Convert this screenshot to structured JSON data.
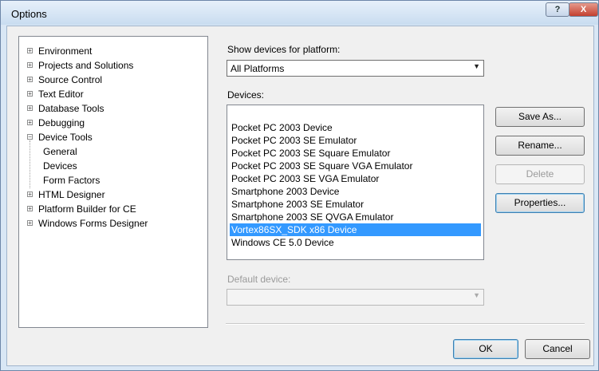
{
  "window": {
    "title": "Options",
    "help_label": "?",
    "close_label": "X"
  },
  "tree": {
    "items": [
      {
        "label": "Environment",
        "expander": "+",
        "level": 0
      },
      {
        "label": "Projects and Solutions",
        "expander": "+",
        "level": 0
      },
      {
        "label": "Source Control",
        "expander": "+",
        "level": 0
      },
      {
        "label": "Text Editor",
        "expander": "+",
        "level": 0
      },
      {
        "label": "Database Tools",
        "expander": "+",
        "level": 0
      },
      {
        "label": "Debugging",
        "expander": "+",
        "level": 0
      },
      {
        "label": "Device Tools",
        "expander": "−",
        "level": 0
      },
      {
        "label": "General",
        "expander": "",
        "level": 1
      },
      {
        "label": "Devices",
        "expander": "",
        "level": 1
      },
      {
        "label": "Form Factors",
        "expander": "",
        "level": 1
      },
      {
        "label": "HTML Designer",
        "expander": "+",
        "level": 0
      },
      {
        "label": "Platform Builder for CE",
        "expander": "+",
        "level": 0
      },
      {
        "label": "Windows Forms Designer",
        "expander": "+",
        "level": 0
      }
    ]
  },
  "platform": {
    "label": "Show devices for platform:",
    "value": "All Platforms"
  },
  "devices": {
    "label": "Devices:",
    "items": [
      "Pocket PC 2003 Device",
      "Pocket PC 2003 SE Emulator",
      "Pocket PC 2003 SE Square Emulator",
      "Pocket PC 2003 SE Square VGA Emulator",
      "Pocket PC 2003 SE VGA Emulator",
      "Smartphone 2003 Device",
      "Smartphone 2003 SE Emulator",
      "Smartphone 2003 SE QVGA Emulator",
      "Vortex86SX_SDK x86 Device",
      "Windows CE 5.0 Device"
    ],
    "selected": "Vortex86SX_SDK x86 Device"
  },
  "buttons": {
    "save_as": "Save As...",
    "rename": "Rename...",
    "delete": "Delete",
    "properties": "Properties...",
    "ok": "OK",
    "cancel": "Cancel"
  },
  "default_device": {
    "label": "Default device:",
    "value": ""
  },
  "colors": {
    "selection": "#3399ff",
    "title_bar": "#d9e7f5",
    "close_button": "#c4402f"
  }
}
